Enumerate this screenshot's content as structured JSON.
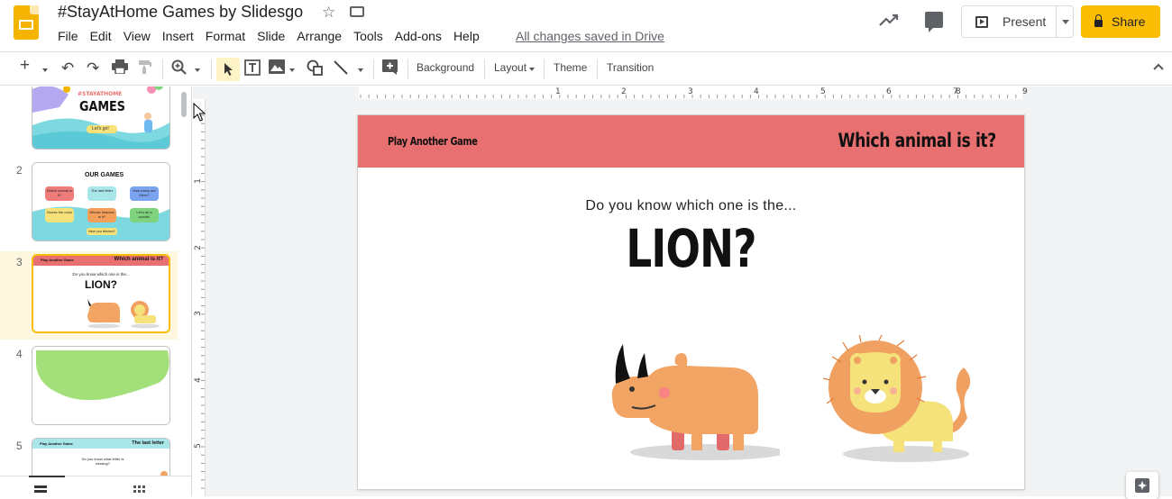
{
  "app": {
    "title": "#StayAtHome Games by Slidesgo",
    "saved_status": "All changes saved in Drive",
    "menu": [
      "File",
      "Edit",
      "View",
      "Insert",
      "Format",
      "Slide",
      "Arrange",
      "Tools",
      "Add-ons",
      "Help"
    ],
    "present_label": "Present",
    "share_label": "Share"
  },
  "toolbar": {
    "background_label": "Background",
    "layout_label": "Layout",
    "theme_label": "Theme",
    "transition_label": "Transition"
  },
  "ruler": {
    "h_labels": [
      "1",
      "2",
      "3",
      "4",
      "5",
      "6",
      "7",
      "8",
      "9"
    ],
    "v_labels": [
      "1",
      "2",
      "3",
      "4",
      "5"
    ]
  },
  "filmstrip": {
    "slides": [
      {
        "number": "",
        "title": "#STAYATHOME",
        "subtitle": "GAMES",
        "button": "Let's go!"
      },
      {
        "number": "2",
        "title": "OUR GAMES",
        "items": [
          "Which animal is it?",
          "The last letter",
          "How many are there?",
          "Guess the color",
          "Whose shadow is it?",
          "Let's do a puzzle!"
        ],
        "footer": "Have you finished?"
      },
      {
        "number": "3",
        "header_left": "Play Another Game",
        "header_right": "Which animal is it?",
        "question": "Do you know which one is the...",
        "big": "LION?"
      },
      {
        "number": "4"
      },
      {
        "number": "5",
        "header_left": "Play Another Game",
        "header_right": "The last letter",
        "question": "Do you know what letter is missing?"
      }
    ]
  },
  "slide": {
    "header_left": "Play Another Game",
    "header_right": "Which animal is it?",
    "question": "Do you know which one is the...",
    "big_word": "LION?"
  },
  "colors": {
    "header_bar": "#e97070",
    "accent": "#fbbc04",
    "rhino": "#f2a464",
    "lion_mane": "#f0a060",
    "lion_body": "#f5e27a"
  }
}
